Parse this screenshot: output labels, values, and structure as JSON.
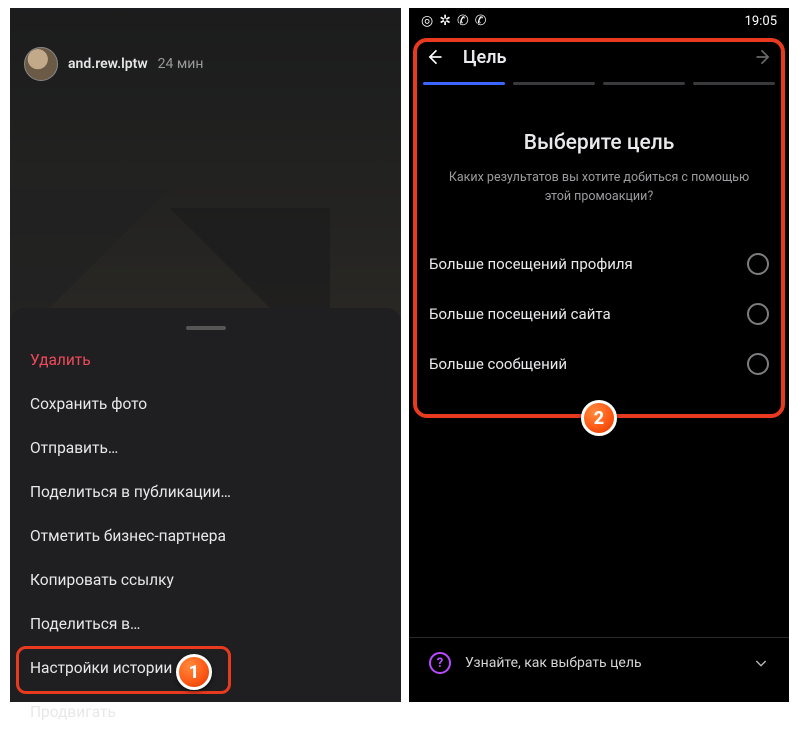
{
  "left": {
    "username": "and.rew.lptw",
    "time": "24 мин",
    "sheet": {
      "delete": "Удалить",
      "save_photo": "Сохранить фото",
      "send": "Отправить…",
      "share_post": "Поделиться в публикации…",
      "tag_partner": "Отметить бизнес-партнера",
      "copy_link": "Копировать ссылку",
      "share_in": "Поделиться в…",
      "story_settings": "Настройки истории",
      "promote": "Продвигать"
    }
  },
  "right": {
    "status_time": "19:05",
    "title": "Цель",
    "heading": "Выберите цель",
    "subheading": "Каких результатов вы хотите добиться с помощью этой промоакции?",
    "options": {
      "profile": "Больше посещений профиля",
      "site": "Больше посещений сайта",
      "messages": "Больше сообщений"
    },
    "help": "Узнайте, как выбрать цель"
  },
  "badges": {
    "one": "1",
    "two": "2"
  }
}
